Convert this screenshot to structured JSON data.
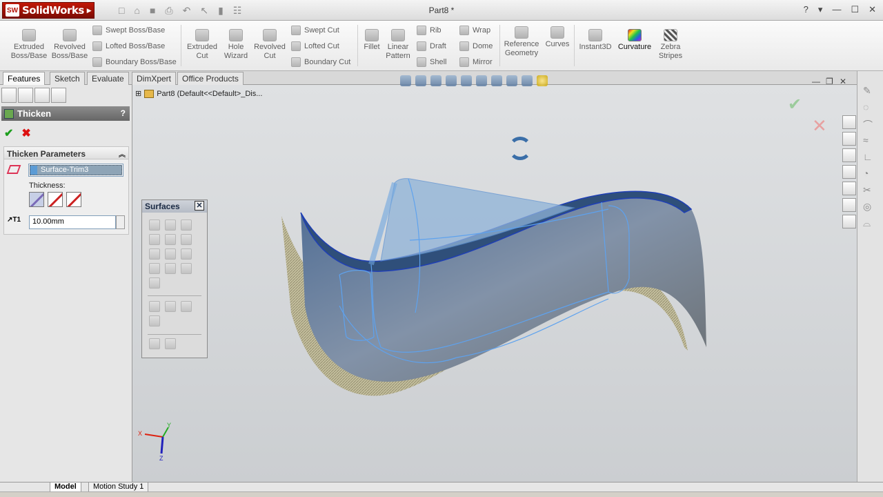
{
  "app": {
    "logo_text": "SolidWorks",
    "doc_title": "Part8 *"
  },
  "toolbar": {
    "extruded_boss": "Extruded Boss/Base",
    "revolved_boss": "Revolved Boss/Base",
    "swept_boss": "Swept Boss/Base",
    "lofted_boss": "Lofted Boss/Base",
    "boundary_boss": "Boundary Boss/Base",
    "extruded_cut": "Extruded Cut",
    "hole_wizard": "Hole Wizard",
    "revolved_cut": "Revolved Cut",
    "swept_cut": "Swept Cut",
    "lofted_cut": "Lofted Cut",
    "boundary_cut": "Boundary Cut",
    "fillet": "Fillet",
    "linear_pattern": "Linear Pattern",
    "rib": "Rib",
    "draft": "Draft",
    "shell": "Shell",
    "wrap": "Wrap",
    "dome": "Dome",
    "mirror": "Mirror",
    "reference_geometry": "Reference Geometry",
    "curves": "Curves",
    "instant3d": "Instant3D",
    "curvature": "Curvature",
    "zebra_stripes": "Zebra Stripes"
  },
  "tabs": [
    "Features",
    "Sketch",
    "Evaluate",
    "DimXpert",
    "Office Products"
  ],
  "property_manager": {
    "title": "Thicken",
    "help": "?",
    "group_title": "Thicken Parameters",
    "selection": "Surface-Trim3",
    "thickness_label": "Thickness:",
    "thickness_value": "10.00mm"
  },
  "viewport": {
    "breadcrumb": "Part8  (Default<<Default>_Dis...",
    "surfaces_toolbar_title": "Surfaces",
    "axis_x": "X",
    "axis_y": "Y",
    "axis_z": "Z"
  },
  "bottom_tabs": [
    "Model",
    "Motion Study 1"
  ],
  "colors": {
    "accent_blue": "#3a6ea8",
    "surface_fill": "#6c87ad",
    "thick_shadow": "#b2ab84"
  }
}
